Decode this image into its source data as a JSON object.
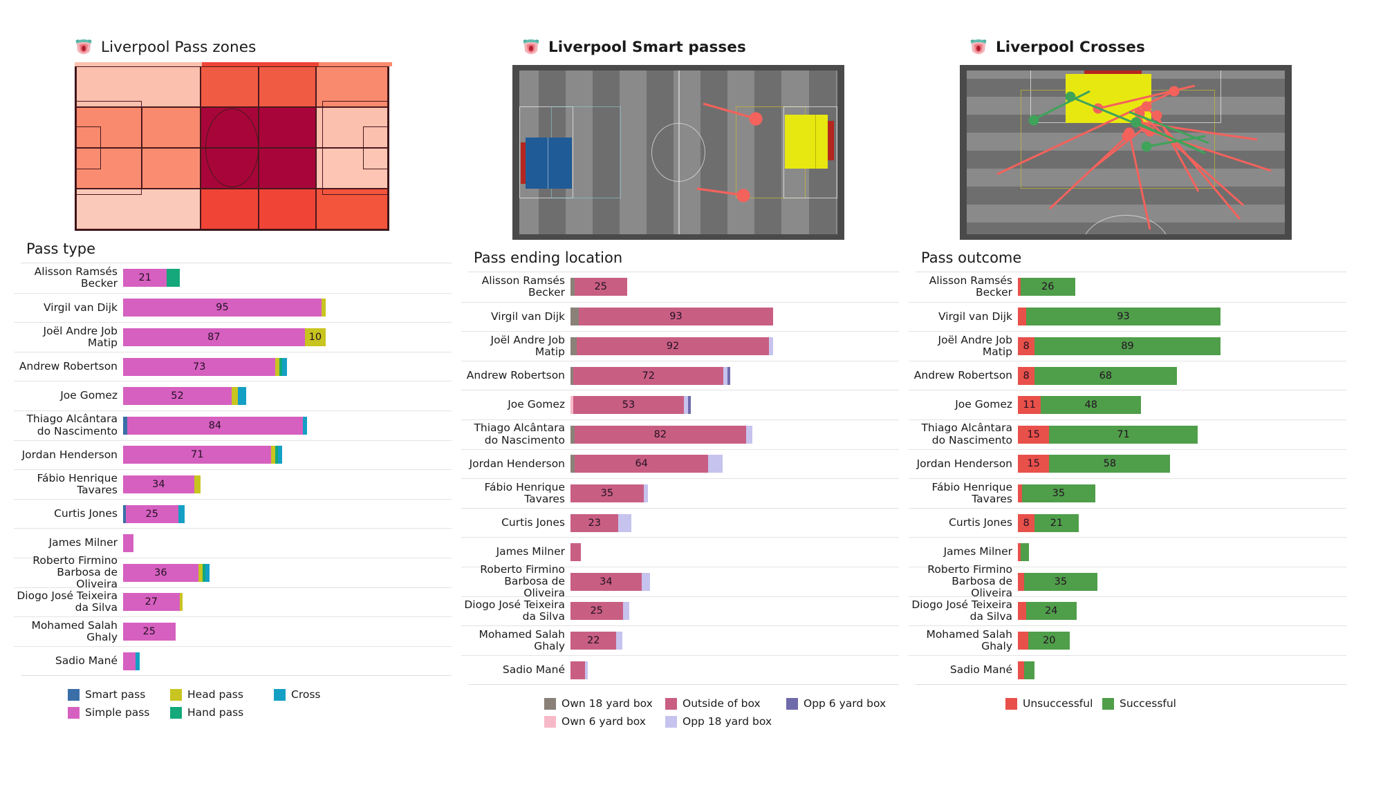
{
  "panels": [
    {
      "title": "Liverpool Pass zones",
      "title_bold": false,
      "viz_kind": "heatmap-pitch",
      "chart_heading": "Pass type"
    },
    {
      "title": "Liverpool Smart passes",
      "title_bold": true,
      "viz_kind": "event-pitch",
      "chart_heading": "Pass ending location"
    },
    {
      "title": "Liverpool Crosses",
      "title_bold": true,
      "viz_kind": "event-pitch",
      "chart_heading": "Pass outcome"
    }
  ],
  "players": [
    "Alisson Ramsés Becker",
    "Virgil van Dijk",
    "Joël Andre Job Matip",
    "Andrew Robertson",
    "Joe Gomez",
    "Thiago Alcântara do Nascimento",
    "Jordan Henderson",
    "Fábio Henrique Tavares",
    "Curtis Jones",
    "James Milner",
    "Roberto Firmino Barbosa de Oliveira",
    "Diogo José Teixeira da Silva",
    "Mohamed  Salah Ghaly",
    "Sadio Mané"
  ],
  "colors": {
    "smart_pass": "#3a6ea8",
    "simple_pass": "#d660c0",
    "head_pass": "#c8c420",
    "hand_pass": "#14a87a",
    "cross": "#14a0c4",
    "own_18_yard_box": "#8a8178",
    "own_6_yard_box": "#f7b9c8",
    "outside_of_box": "#c85f82",
    "opp_18_yard_box": "#c6c3ee",
    "opp_6_yard_box": "#6f6bab",
    "unsuccessful": "#e8504a",
    "successful": "#4f9e4a",
    "heat_max": "#a8063a",
    "heat_hot": "#ef4436",
    "heat_mid": "#f98a6d",
    "heat_low": "#fbc0ae",
    "heat_lowest": "#fcccbc"
  },
  "chart_data": [
    {
      "type": "bar",
      "orientation": "horizontal",
      "stacked": true,
      "title": "Pass type",
      "categories": [
        "Alisson Ramsés Becker",
        "Virgil van Dijk",
        "Joël Andre Job Matip",
        "Andrew Robertson",
        "Joe Gomez",
        "Thiago Alcântara do Nascimento",
        "Jordan Henderson",
        "Fábio Henrique Tavares",
        "Curtis Jones",
        "James Milner",
        "Roberto Firmino Barbosa de Oliveira",
        "Diogo José Teixeira da Silva",
        "Mohamed  Salah Ghaly",
        "Sadio Mané"
      ],
      "series": [
        {
          "name": "Smart pass",
          "color": "#3a6ea8",
          "values": [
            0,
            0,
            0,
            0,
            0,
            2,
            0,
            0,
            1,
            0,
            0,
            0,
            0,
            0
          ]
        },
        {
          "name": "Simple pass",
          "color": "#d660c0",
          "values": [
            21,
            95,
            87,
            73,
            52,
            84,
            71,
            34,
            25,
            5,
            36,
            27,
            25,
            6
          ]
        },
        {
          "name": "Head pass",
          "color": "#c8c420",
          "values": [
            0,
            2,
            10,
            2,
            3,
            0,
            2,
            3,
            0,
            0,
            2,
            1,
            0,
            0
          ]
        },
        {
          "name": "Hand pass",
          "color": "#14a87a",
          "values": [
            6,
            0,
            0,
            1,
            0,
            0,
            1,
            0,
            0,
            0,
            1,
            0,
            0,
            0
          ]
        },
        {
          "name": "Cross",
          "color": "#14a0c4",
          "values": [
            0,
            0,
            0,
            2,
            4,
            2,
            2,
            0,
            3,
            0,
            2,
            0,
            0,
            2
          ]
        }
      ],
      "legend": [
        "Smart pass",
        "Simple pass",
        "Head pass",
        "Hand pass",
        "Cross"
      ],
      "legend_position": "bottom"
    },
    {
      "type": "bar",
      "orientation": "horizontal",
      "stacked": true,
      "title": "Pass ending location",
      "categories": [
        "Alisson Ramsés Becker",
        "Virgil van Dijk",
        "Joël Andre Job Matip",
        "Andrew Robertson",
        "Joe Gomez",
        "Thiago Alcântara do Nascimento",
        "Jordan Henderson",
        "Fábio Henrique Tavares",
        "Curtis Jones",
        "James Milner",
        "Roberto Firmino Barbosa de Oliveira",
        "Diogo José Teixeira da Silva",
        "Mohamed  Salah Ghaly",
        "Sadio Mané"
      ],
      "series": [
        {
          "name": "Own 18 yard box",
          "color": "#8a8178",
          "values": [
            2,
            4,
            3,
            1,
            0,
            2,
            2,
            0,
            0,
            0,
            0,
            0,
            0,
            0
          ]
        },
        {
          "name": "Own 6 yard box",
          "color": "#f7b9c8",
          "values": [
            0,
            0,
            0,
            0,
            1,
            0,
            0,
            0,
            0,
            0,
            0,
            0,
            0,
            0
          ]
        },
        {
          "name": "Outside of box",
          "color": "#c85f82",
          "values": [
            25,
            93,
            92,
            72,
            53,
            82,
            64,
            35,
            23,
            5,
            34,
            25,
            22,
            7
          ]
        },
        {
          "name": "Opp 18 yard box",
          "color": "#c6c3ee",
          "values": [
            0,
            0,
            2,
            2,
            2,
            3,
            7,
            2,
            6,
            0,
            4,
            3,
            3,
            1
          ]
        },
        {
          "name": "Opp 6 yard box",
          "color": "#6f6bab",
          "values": [
            0,
            0,
            0,
            1,
            1,
            0,
            0,
            0,
            0,
            0,
            0,
            0,
            0,
            0
          ]
        }
      ],
      "legend": [
        "Own 18 yard box",
        "Own 6 yard box",
        "Outside of box",
        "Opp 18 yard box",
        "Opp 6 yard box"
      ],
      "legend_position": "bottom"
    },
    {
      "type": "bar",
      "orientation": "horizontal",
      "stacked": true,
      "title": "Pass outcome",
      "categories": [
        "Alisson Ramsés Becker",
        "Virgil van Dijk",
        "Joël Andre Job Matip",
        "Andrew Robertson",
        "Joe Gomez",
        "Thiago Alcântara do Nascimento",
        "Jordan Henderson",
        "Fábio Henrique Tavares",
        "Curtis Jones",
        "James Milner",
        "Roberto Firmino Barbosa de Oliveira",
        "Diogo José Teixeira da Silva",
        "Mohamed  Salah Ghaly",
        "Sadio Mané"
      ],
      "series": [
        {
          "name": "Unsuccessful",
          "color": "#e8504a",
          "values": [
            1,
            4,
            8,
            8,
            11,
            15,
            15,
            2,
            8,
            1,
            3,
            4,
            5,
            3
          ]
        },
        {
          "name": "Successful",
          "color": "#4f9e4a",
          "values": [
            26,
            93,
            89,
            68,
            48,
            71,
            58,
            35,
            21,
            4,
            35,
            24,
            20,
            5
          ]
        }
      ],
      "legend": [
        "Unsuccessful",
        "Successful"
      ],
      "legend_position": "bottom"
    }
  ],
  "heatmap": {
    "cols": 5,
    "rows": 4,
    "values": [
      [
        "low",
        "low",
        "hot",
        "hot",
        "mid"
      ],
      [
        "mid",
        "mid",
        "max",
        "max",
        "low"
      ],
      [
        "mid",
        "mid",
        "max",
        "max",
        "low"
      ],
      [
        "low",
        "low",
        "hot",
        "hot",
        "hot"
      ]
    ]
  }
}
